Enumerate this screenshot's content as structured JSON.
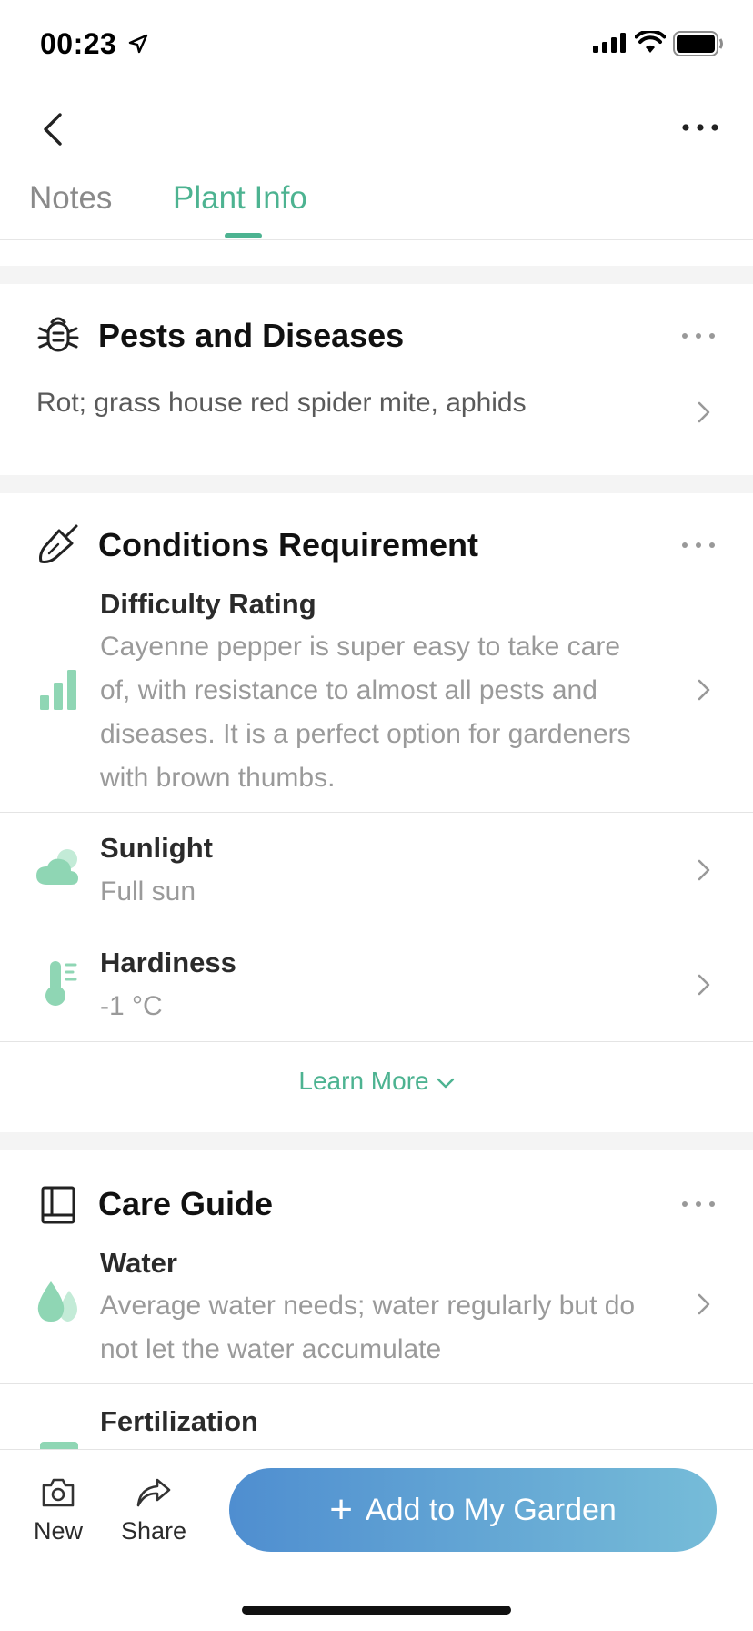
{
  "status_bar": {
    "time": "00:23"
  },
  "tabs": {
    "notes": "Notes",
    "plant_info": "Plant Info",
    "active": "plant_info"
  },
  "pests": {
    "title": "Pests and Diseases",
    "text": "Rot; grass house red spider mite, aphids"
  },
  "conditions": {
    "title": "Conditions Requirement",
    "difficulty": {
      "label": "Difficulty Rating",
      "lines": [
        "Cayenne pepper is super easy to take care",
        "of, with resistance to almost all pests and",
        "diseases. It is a perfect option for gardeners",
        "with brown thumbs."
      ]
    },
    "sunlight": {
      "label": "Sunlight",
      "value": "Full sun"
    },
    "hardiness": {
      "label": "Hardiness",
      "value": "-1 °C"
    },
    "learn_more": "Learn More"
  },
  "care_guide": {
    "title": "Care Guide",
    "water": {
      "label": "Water",
      "lines": [
        "Average water needs; water regularly but do",
        "not let the water accumulate"
      ]
    },
    "fertilization": {
      "label": "Fertilization"
    }
  },
  "bottom_bar": {
    "new_label": "New",
    "share_label": "Share",
    "add_label": "Add to My Garden"
  },
  "colors": {
    "accent": "#4db391",
    "icon_green": "#8fd6b4",
    "button_start": "#4f8ed0",
    "button_end": "#76bcd8"
  },
  "icons": [
    "location-arrow-icon",
    "signal-icon",
    "wifi-icon",
    "battery-icon",
    "back-chevron-icon",
    "more-icon",
    "bug-icon",
    "trowel-icon",
    "bar-chart-icon",
    "cloud-icon",
    "thermometer-icon",
    "book-icon",
    "water-drop-icon",
    "camera-icon",
    "share-icon",
    "plus-icon"
  ]
}
